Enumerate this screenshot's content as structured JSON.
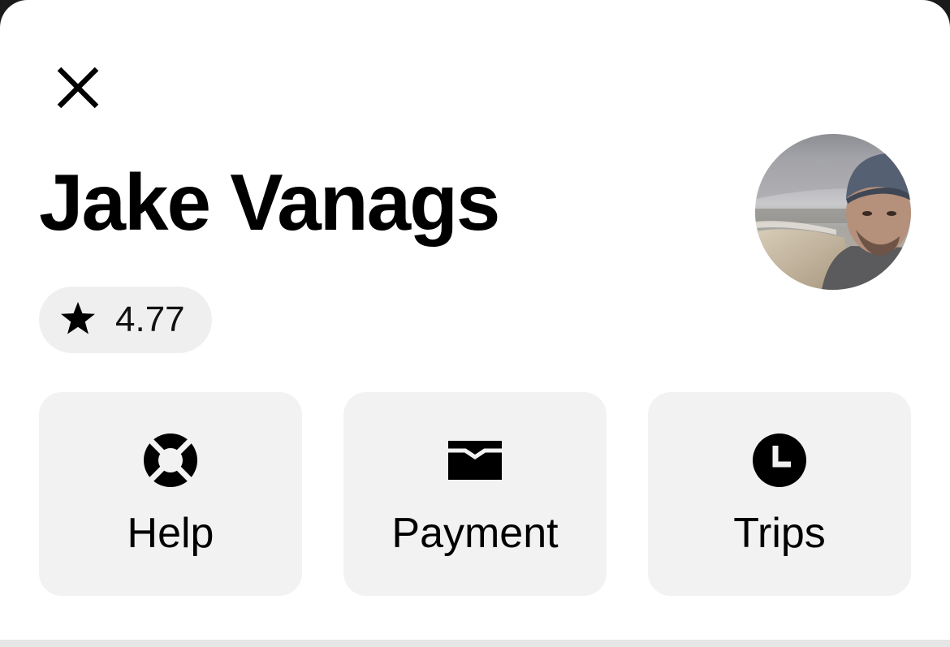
{
  "profile": {
    "name": "Jake Vanags",
    "rating": "4.77"
  },
  "actions": [
    {
      "label": "Help",
      "icon": "lifebuoy-icon"
    },
    {
      "label": "Payment",
      "icon": "wallet-icon"
    },
    {
      "label": "Trips",
      "icon": "clock-icon"
    }
  ],
  "icons": {
    "close": "close-icon",
    "rating": "star-icon"
  },
  "colors": {
    "background": "#ffffff",
    "tile": "#f2f2f2",
    "pill": "#efefef",
    "text": "#000000"
  }
}
